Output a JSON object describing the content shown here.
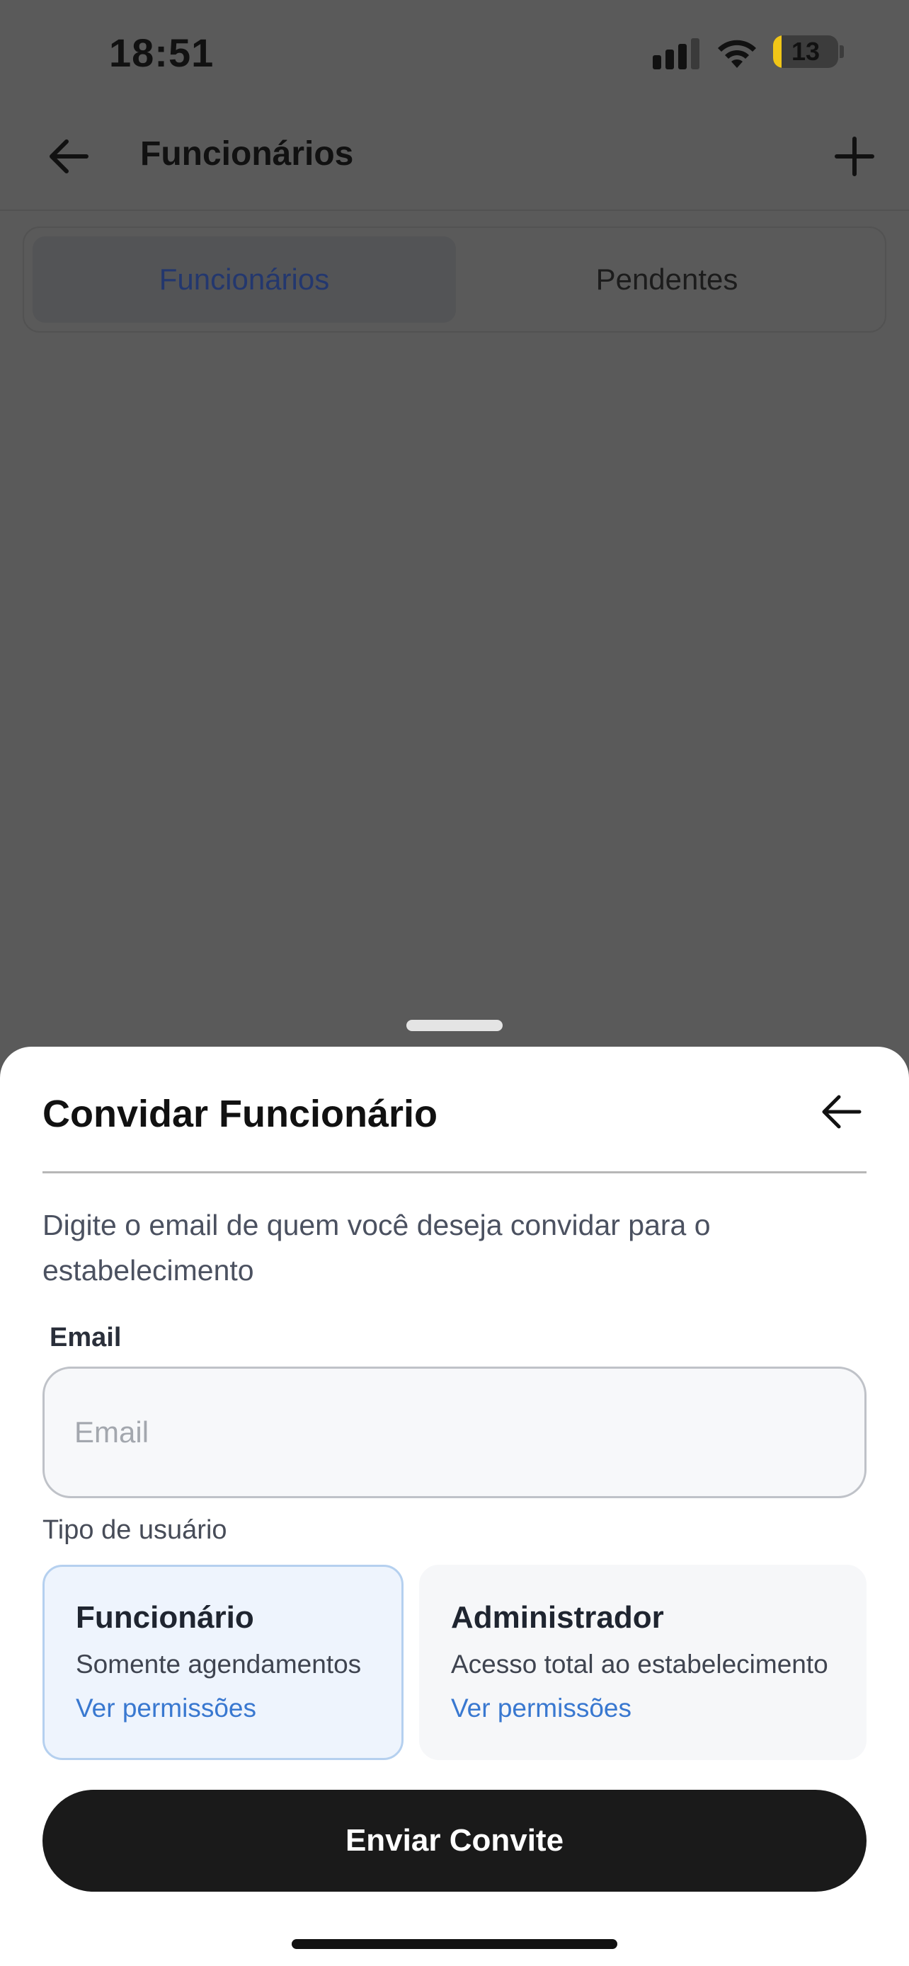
{
  "status_bar": {
    "time": "18:51",
    "battery": "13",
    "battery_level_percent": 13
  },
  "header": {
    "title": "Funcionários"
  },
  "tabs": [
    {
      "label": "Funcionários",
      "active": true
    },
    {
      "label": "Pendentes",
      "active": false
    }
  ],
  "sheet": {
    "title": "Convidar Funcionário",
    "description": "Digite o email de quem você deseja convidar para o estabelecimento",
    "email_label": "Email",
    "email_placeholder": "Email",
    "email_value": "",
    "user_type_label": "Tipo de usuário",
    "roles": [
      {
        "title": "Funcionário",
        "description": "Somente agendamentos",
        "link": "Ver permissões",
        "selected": true
      },
      {
        "title": "Administrador",
        "description": "Acesso total ao estabelecimento",
        "link": "Ver permissões",
        "selected": false
      }
    ],
    "submit_label": "Enviar Convite"
  },
  "colors": {
    "accent_link": "#3978d0",
    "button": "#1a1a1a",
    "selected_card": "#eef4fd",
    "battery": "#f1c617"
  },
  "icons": [
    "signal-icon",
    "wifi-icon",
    "battery-icon",
    "back-arrow-icon",
    "plus-icon"
  ]
}
